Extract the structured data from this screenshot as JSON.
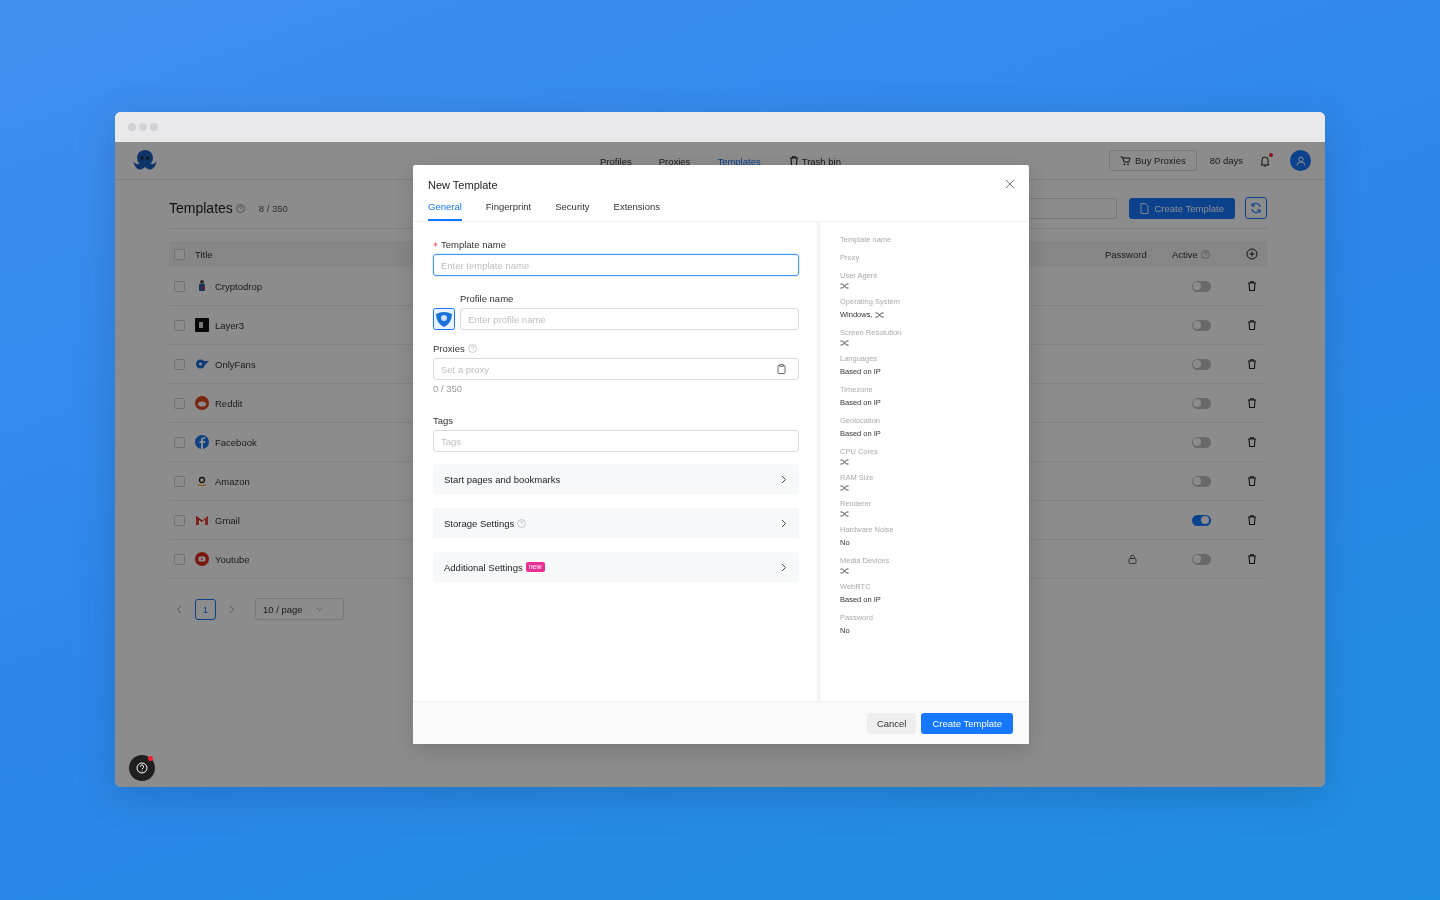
{
  "header": {
    "nav": [
      {
        "label": "Profiles",
        "selected": false
      },
      {
        "label": "Proxies",
        "selected": false
      },
      {
        "label": "Templates",
        "selected": true
      },
      {
        "label": "Trash bin",
        "selected": false,
        "kind": "trash"
      }
    ],
    "buy_button": "Buy Proxies",
    "days": "80 days",
    "notification_unread": true
  },
  "page": {
    "title": "Templates",
    "count": "8 / 350",
    "create_button": "Create Template"
  },
  "table": {
    "columns": [
      "Title",
      "Password",
      "Active"
    ],
    "header_checked": false,
    "rows": [
      {
        "title": "Cryptodrop",
        "checked": false,
        "password": false,
        "active": false
      },
      {
        "title": "Layer3",
        "checked": false,
        "password": false,
        "active": false
      },
      {
        "title": "OnlyFans",
        "checked": false,
        "password": false,
        "active": false
      },
      {
        "title": "Reddit",
        "checked": false,
        "password": false,
        "active": false
      },
      {
        "title": "Facebook",
        "checked": false,
        "password": false,
        "active": false
      },
      {
        "title": "Amazon",
        "checked": false,
        "password": false,
        "active": false
      },
      {
        "title": "Gmail",
        "checked": false,
        "password": false,
        "active": true
      },
      {
        "title": "Youtube",
        "checked": false,
        "password": true,
        "active": false
      }
    ]
  },
  "pagination": {
    "pages": [
      {
        "label": "1",
        "selected": true
      }
    ],
    "page_size": "10 / page"
  },
  "modal": {
    "title": "New Template",
    "tabs": [
      {
        "label": "General",
        "selected": true
      },
      {
        "label": "Fingerprint",
        "selected": false
      },
      {
        "label": "Security",
        "selected": false
      },
      {
        "label": "Extensions",
        "selected": false
      }
    ],
    "template_name": {
      "label": "Template name",
      "required": true,
      "placeholder": "Enter template name",
      "focused": true
    },
    "profile_name": {
      "label": "Profile name",
      "placeholder": "Enter profile name"
    },
    "proxies": {
      "label": "Proxies",
      "placeholder": "Set a proxy",
      "counter": "0 / 350"
    },
    "tags": {
      "label": "Tags",
      "placeholder": "Tags"
    },
    "sections": [
      {
        "label": "Start pages and bookmarks",
        "help": false
      },
      {
        "label": "Storage Settings",
        "help": true
      },
      {
        "label": "Additional Settings",
        "help": false,
        "badge": "new"
      }
    ],
    "summary": [
      {
        "label": "Template name",
        "random": false
      },
      {
        "label": "Proxy",
        "random": false
      },
      {
        "label": "User Agent",
        "random": true
      },
      {
        "label": "Operating System",
        "value": "Windows,",
        "random": true
      },
      {
        "label": "Screen Resolution",
        "random": true
      },
      {
        "label": "Languages",
        "value": "Based on IP",
        "random": false
      },
      {
        "label": "Timezone",
        "value": "Based on IP",
        "random": false
      },
      {
        "label": "Geolocation",
        "value": "Based on IP",
        "random": false
      },
      {
        "label": "CPU Cores",
        "random": true
      },
      {
        "label": "RAM Size",
        "random": true
      },
      {
        "label": "Renderer",
        "random": true
      },
      {
        "label": "Hardware Noise",
        "value": "No",
        "random": false
      },
      {
        "label": "Media Devices",
        "random": true
      },
      {
        "label": "WebRTC",
        "value": "Based on IP",
        "random": false
      },
      {
        "label": "Password",
        "value": "No",
        "random": false
      }
    ],
    "cancel_button": "Cancel",
    "submit_button": "Create Template"
  },
  "help_unread": true
}
